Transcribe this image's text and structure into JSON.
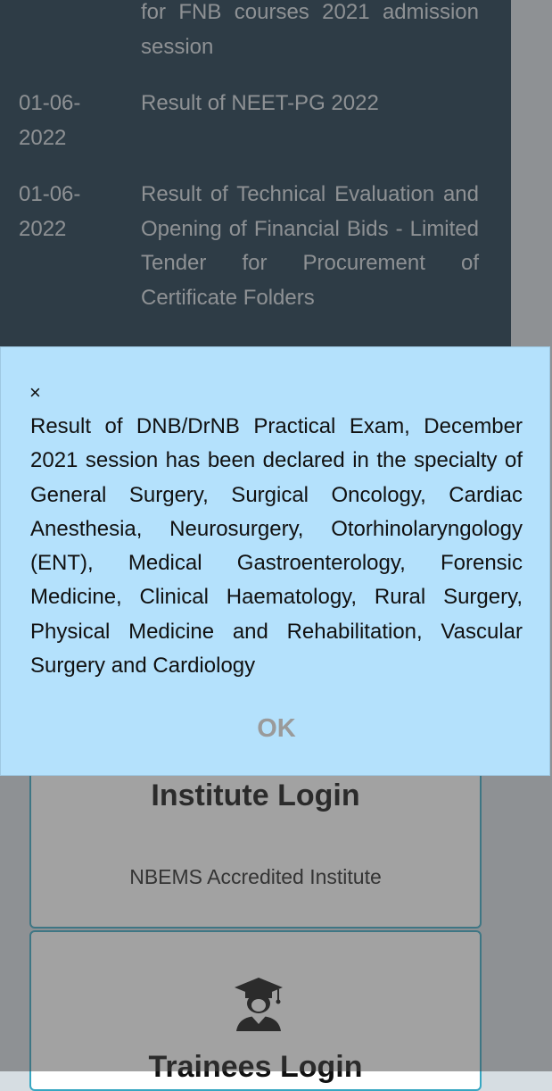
{
  "news": [
    {
      "date": "",
      "text": "for FNB courses 2021 admission session"
    },
    {
      "date": "01-06-2022",
      "text": "Result of NEET-PG 2022"
    },
    {
      "date": "01-06-2022",
      "text": "Result of Technical Evaluation and Opening of Financial Bids - Limited Tender for Procurement of Certificate Folders"
    }
  ],
  "cards": {
    "institute": {
      "title": "Institute Login",
      "subtitle": "NBEMS Accredited Institute"
    },
    "trainee": {
      "title": "Trainees Login",
      "icon": "graduate-user-icon"
    }
  },
  "modal": {
    "close_label": "×",
    "message": "Result of DNB/DrNB Practical Exam, December 2021 session has been declared in the specialty of General Surgery, Surgical Oncology, Cardiac Anesthesia, Neurosurgery, Otorhinolaryngology (ENT), Medical Gastroenterology, Forensic Medicine, Clinical Haematology, Rural Surgery, Physical Medicine and Rehabilitation, Vascular Surgery and Cardiology",
    "ok_label": "OK"
  },
  "colors": {
    "news_panel_bg": "#163347",
    "modal_bg": "#b4e1fc",
    "card_border": "#37a7c2",
    "ok_text": "#9a9a9a"
  }
}
